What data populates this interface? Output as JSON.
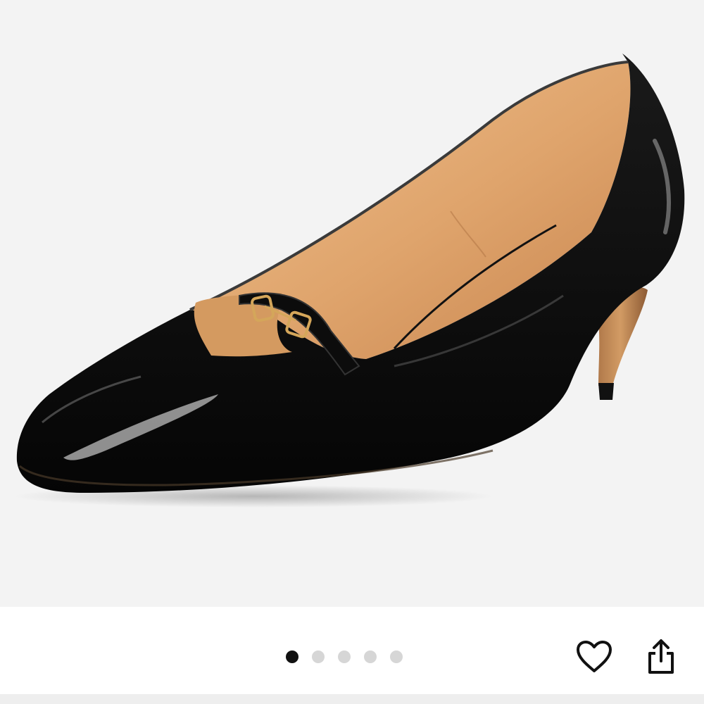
{
  "product_image": {
    "subject": "shoe-photo",
    "background": "#f3f3f3"
  },
  "carousel": {
    "total_images": 5,
    "active_index": 0,
    "active_color": "#111111",
    "inactive_color": "#d6d6d6"
  },
  "actions": {
    "favorite_icon": "heart-icon",
    "share_icon": "share-icon"
  }
}
